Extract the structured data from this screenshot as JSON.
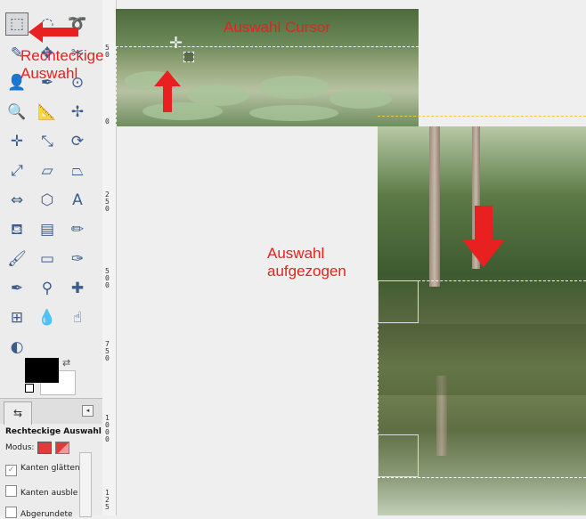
{
  "annotations": {
    "rect_select": "Rechteckige\nAuswahl",
    "cursor": "Auswahl Cursor",
    "drawn": "Auswahl\naufgezogen"
  },
  "ruler": {
    "ticks": [
      "5\n0",
      "0",
      "2\n5\n0",
      "5\n0\n0",
      "7\n5\n0",
      "1\n0\n0\n0",
      "1\n2\n5"
    ]
  },
  "tools": [
    {
      "name": "rect-select-tool-icon",
      "glyph": "⬚"
    },
    {
      "name": "ellipse-select-tool-icon",
      "glyph": "◌"
    },
    {
      "name": "lasso-tool-icon",
      "glyph": "➰"
    },
    {
      "name": "fuzzy-select-tool-icon",
      "glyph": "✎"
    },
    {
      "name": "select-by-color-tool-icon",
      "glyph": "✥"
    },
    {
      "name": "scissors-tool-icon",
      "glyph": "✂"
    },
    {
      "name": "foreground-select-tool-icon",
      "glyph": "👤"
    },
    {
      "name": "paths-tool-icon",
      "glyph": "✒"
    },
    {
      "name": "color-picker-tool-icon",
      "glyph": "⊙"
    },
    {
      "name": "zoom-tool-icon",
      "glyph": "🔍"
    },
    {
      "name": "measure-tool-icon",
      "glyph": "📐"
    },
    {
      "name": "move-tool-icon",
      "glyph": "✢"
    },
    {
      "name": "align-tool-icon",
      "glyph": "✛"
    },
    {
      "name": "crop-tool-icon",
      "glyph": "⤡"
    },
    {
      "name": "rotate-tool-icon",
      "glyph": "⟳"
    },
    {
      "name": "scale-tool-icon",
      "glyph": "⤢"
    },
    {
      "name": "shear-tool-icon",
      "glyph": "▱"
    },
    {
      "name": "perspective-tool-icon",
      "glyph": "⏢"
    },
    {
      "name": "flip-tool-icon",
      "glyph": "⇔"
    },
    {
      "name": "cage-transform-tool-icon",
      "glyph": "⬡"
    },
    {
      "name": "text-tool-icon",
      "glyph": "A"
    },
    {
      "name": "bucket-fill-tool-icon",
      "glyph": "⛾"
    },
    {
      "name": "blend-tool-icon",
      "glyph": "▤"
    },
    {
      "name": "pencil-tool-icon",
      "glyph": "✏"
    },
    {
      "name": "paintbrush-tool-icon",
      "glyph": "🖌"
    },
    {
      "name": "eraser-tool-icon",
      "glyph": "▭"
    },
    {
      "name": "airbrush-tool-icon",
      "glyph": "✑"
    },
    {
      "name": "ink-tool-icon",
      "glyph": "✒"
    },
    {
      "name": "clone-tool-icon",
      "glyph": "⚲"
    },
    {
      "name": "heal-tool-icon",
      "glyph": "✚"
    },
    {
      "name": "perspective-clone-tool-icon",
      "glyph": "⊞"
    },
    {
      "name": "blur-tool-icon",
      "glyph": "💧"
    },
    {
      "name": "smudge-tool-icon",
      "glyph": "☝"
    },
    {
      "name": "dodge-burn-tool-icon",
      "glyph": "◐"
    }
  ],
  "options": {
    "tab_icon": "⇆",
    "menu_icon": "◂",
    "title": "Rechteckige Auswahl",
    "mode_label": "Modus:",
    "antialias": "Kanten glätten",
    "feather": "Kanten ausble",
    "rounded": "Abgerundete"
  },
  "colors": {
    "accent": "#e8201f",
    "selection_mode_red": "#e23a3a"
  }
}
